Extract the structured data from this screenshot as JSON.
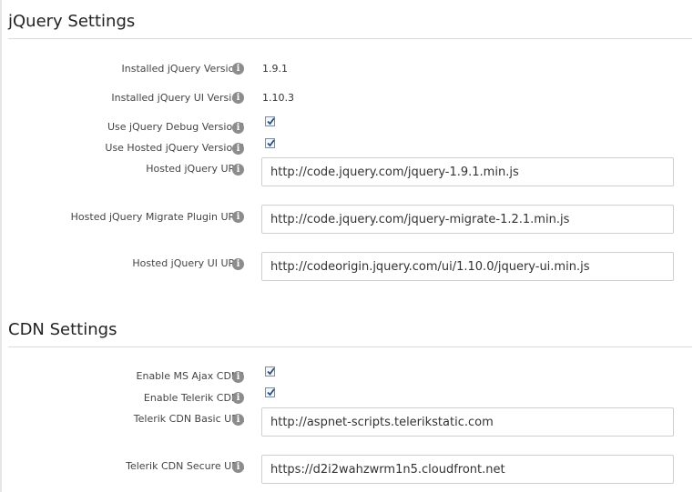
{
  "sections": [
    {
      "title": "jQuery Settings",
      "rows": [
        {
          "label": "Installed jQuery Version:",
          "type": "text",
          "value": "1.9.1"
        },
        {
          "label": "Installed jQuery UI Version",
          "type": "text",
          "value": "1.10.3"
        },
        {
          "label": "Use jQuery Debug Version?",
          "type": "checkbox",
          "checked": true
        },
        {
          "label": "Use Hosted jQuery Version?",
          "type": "checkbox",
          "checked": true
        },
        {
          "label": "Hosted jQuery URL:",
          "type": "input",
          "value": "http://code.jquery.com/jquery-1.9.1.min.js"
        },
        {
          "label": "Hosted jQuery Migrate Plugin URL:",
          "type": "input",
          "value": "http://code.jquery.com/jquery-migrate-1.2.1.min.js"
        },
        {
          "label": "Hosted jQuery UI URL:",
          "type": "input",
          "value": "http://codeorigin.jquery.com/ui/1.10.0/jquery-ui.min.js"
        }
      ]
    },
    {
      "title": "CDN Settings",
      "rows": [
        {
          "label": "Enable MS Ajax CDN?",
          "type": "checkbox",
          "checked": true
        },
        {
          "label": "Enable Telerik CDN?",
          "type": "checkbox",
          "checked": true
        },
        {
          "label": "Telerik CDN Basic URL",
          "type": "input",
          "value": "http://aspnet-scripts.telerikstatic.com"
        },
        {
          "label": "Telerik CDN Secure URL",
          "type": "input",
          "value": "https://d2i2wahzwrm1n5.cloudfront.net"
        }
      ]
    }
  ],
  "icons": {
    "info": "info-icon",
    "check": "checkmark-icon"
  },
  "colors": {
    "info_icon": "#8c8c8c",
    "checkbox_border": "#7a8da3",
    "check_mark": "#2b4f7e",
    "input_border": "#cfcfcf"
  }
}
